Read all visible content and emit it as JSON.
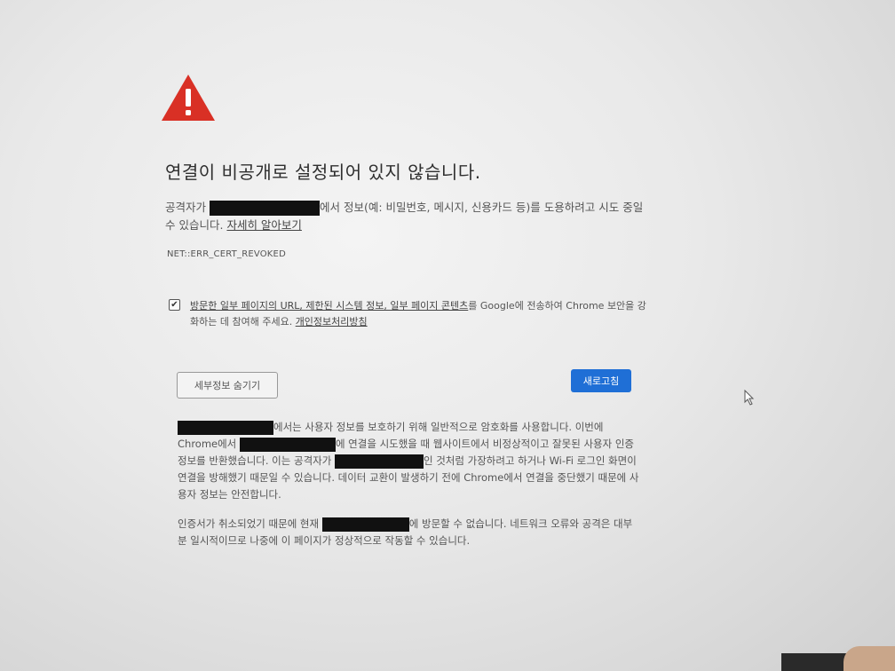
{
  "page": {
    "title": "연결이 비공개로 설정되어 있지 않습니다.",
    "description_prefix": "공격자가",
    "description_suffix": "에서 정보(예: 비밀번호, 메시지, 신용카드 등)를 도용하려고 시도 중일 수 있습니다.",
    "learn_more_link": "자세히 알아보기",
    "error_code": "NET::ERR_CERT_REVOKED"
  },
  "checkbox": {
    "checked": true,
    "text_link": "방문한 일부 페이지의 URL, 제한된 시스템 정보, 일부 페이지 콘텐츠",
    "text_middle": "를 Google에 전송하여 Chrome 보안을 강화하는 데 참여해 주세요.",
    "privacy_link": "개인정보처리방침"
  },
  "buttons": {
    "details_label": "세부정보 숨기기",
    "reload_label": "새로고침"
  },
  "details": {
    "p1_part1": "에서는 사용자 정보를 보호하기 위해 일반적으로 암호화를 사용합니다. 이번에 Chrome에서",
    "p1_part2": "에 연결을 시도했을 때 웹사이트에서 비정상적이고 잘못된 사용자 인증 정보를 반환했습니다. 이는 공격자가",
    "p1_part3": "인 것처럼 가장하려고 하거나 Wi-Fi 로그인 화면이 연결을 방해했기 때문일 수 있습니다. 데이터 교환이 발생하기 전에 Chrome에서 연결을 중단했기 때문에 사용자 정보는 안전합니다.",
    "p2_part1": "인증서가 취소되었기 때문에 현재",
    "p2_part2": "에 방문할 수 없습니다. 네트워크 오류와 공격은 대부분 일시적이므로 나중에 이 페이지가 정상적으로 작동할 수 있습니다."
  },
  "icons": {
    "warning": "warning-triangle-icon",
    "checkbox_mark": "✔"
  },
  "colors": {
    "warning_red": "#d93025",
    "button_blue": "#1f6fd6"
  }
}
